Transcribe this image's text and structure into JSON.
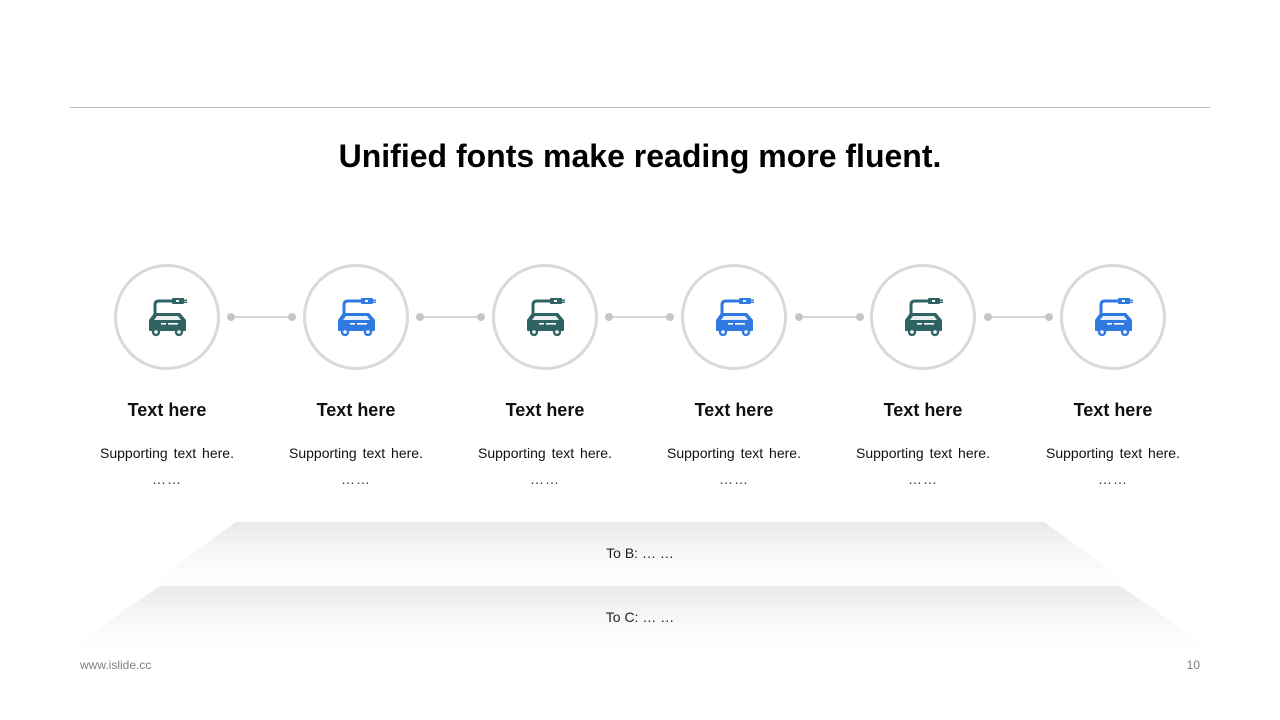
{
  "title": "Unified fonts make reading more fluent.",
  "colors": {
    "teal": "#2f6263",
    "blue": "#2f7ae0",
    "circle_border": "#d9d9d9",
    "connector": "#d6d6d6"
  },
  "steps": [
    {
      "icon": "electric-car-charging-icon",
      "color": "teal",
      "title": "Text here",
      "subtitle": "Supporting text here.",
      "ellipsis": "……"
    },
    {
      "icon": "electric-car-charging-icon",
      "color": "blue",
      "title": "Text here",
      "subtitle": "Supporting text here.",
      "ellipsis": "……"
    },
    {
      "icon": "electric-car-charging-icon",
      "color": "teal",
      "title": "Text here",
      "subtitle": "Supporting text here.",
      "ellipsis": "……"
    },
    {
      "icon": "electric-car-charging-icon",
      "color": "blue",
      "title": "Text here",
      "subtitle": "Supporting text here.",
      "ellipsis": "……"
    },
    {
      "icon": "electric-car-charging-icon",
      "color": "teal",
      "title": "Text here",
      "subtitle": "Supporting text here.",
      "ellipsis": "……"
    },
    {
      "icon": "electric-car-charging-icon",
      "color": "blue",
      "title": "Text here",
      "subtitle": "Supporting text here.",
      "ellipsis": "……"
    }
  ],
  "bands": [
    {
      "label": "To B: … …"
    },
    {
      "label": "To C: … …"
    }
  ],
  "footer": {
    "url": "www.islide.cc",
    "page": "10"
  }
}
